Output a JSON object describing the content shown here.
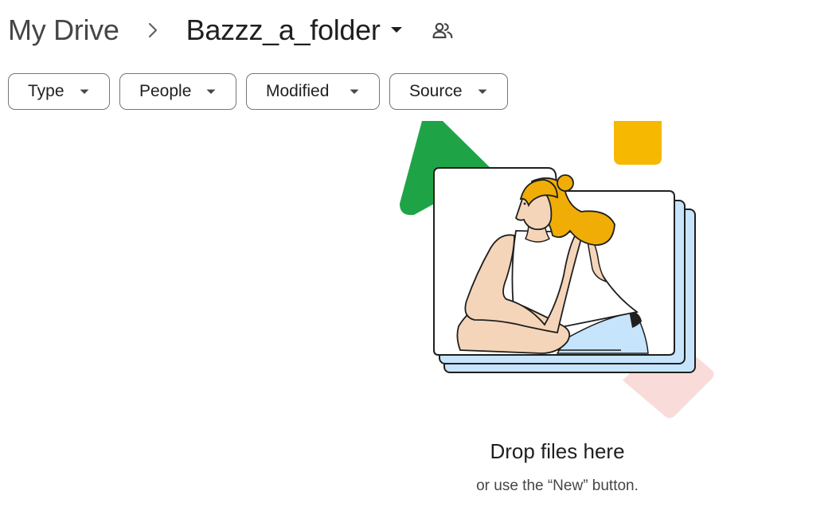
{
  "breadcrumb": {
    "root": "My Drive",
    "current": "Bazzz_a_folder"
  },
  "filters": {
    "type": "Type",
    "people": "People",
    "modified": "Modified",
    "source": "Source"
  },
  "empty_state": {
    "title": "Drop files here",
    "subtitle": "or use the “New” button."
  },
  "colors": {
    "green": "#1ea446",
    "yellow": "#f6b800",
    "light_blue": "#c6e4fb",
    "pink": "#f9dcd9",
    "skin": "#f5d5b9",
    "hair": "#f0ad06",
    "outline": "#1f1f1f"
  },
  "icons": {
    "separator": "chevron-right-icon",
    "folder_menu": "caret-down-icon",
    "shared": "shared-people-icon",
    "filter_menu": "caret-down-icon"
  }
}
